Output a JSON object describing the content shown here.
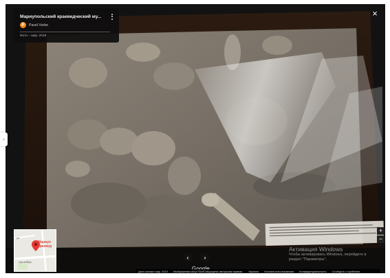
{
  "info_card": {
    "title": "Мариупольский краеведческий му...",
    "author_initial": "P",
    "author": "Pavel Verbe",
    "date": "Фото – мар. 2019"
  },
  "minimap": {
    "place_label_1": "Мариуп",
    "place_label_2": "краевед",
    "street_label": "тролейбус",
    "street_label_2": "ул."
  },
  "nav": {
    "prev": "‹",
    "next": "›",
    "google": "Google"
  },
  "zoom": {
    "in": "+",
    "out": "−"
  },
  "close": "×",
  "collapse": "›",
  "watermark": {
    "title": "Активация Windows",
    "line1": "Чтобы активировать Windows, перейдите в",
    "line2": "раздел \"Параметры\"."
  },
  "footer": {
    "date": "Дата съемки: мар. 2019",
    "notice": "Изображения могут быть защищены авторским правом.",
    "country": "Украина",
    "terms": "Условия использования",
    "privacy": "Конфиденциальность",
    "report": "Сообщить о проблеме"
  }
}
